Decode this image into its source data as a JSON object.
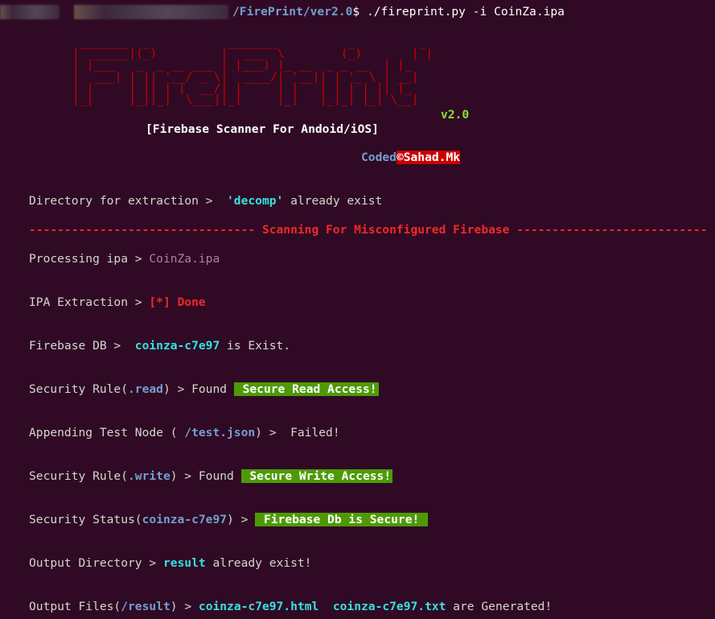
{
  "prompt": {
    "path": "/FirePrint/ver2.0",
    "symbol": "$",
    "command": " ./fireprint.py -i CoinZa.ipa"
  },
  "banner": {
    "ascii_art": " _______  _           _______          _         _\n|  _____|(_)         |  ___  \\        (_)       | |\n| |___   _  _ __ ___ | |___) )_ __  _ _ __  | |_\n|  ___| | || '__/ _ \\|  ____/| '__|| | '_ \\ | __|\n| |     | || | |  __/| |     | |   | | | | || |_\n|_|     |_||_|  \\___||_|     |_|   |_|_| |_| \\__|",
    "version": "v2.0",
    "subtitle": "[Firebase Scanner For Andoid/iOS]",
    "coded_label": "Coded",
    "author": "©Sahad.Mk"
  },
  "output": {
    "l1_a": "Directory for extraction >  ",
    "l1_b": "'decomp'",
    "l1_c": " already exist",
    "separator": "-------------------------------- Scanning For Misconfigured Firebase ---------------------------",
    "l2_a": "Processing ipa > ",
    "l2_b": "CoinZa.ipa",
    "l3_a": "IPA Extraction > ",
    "l3_b": "[*] Done",
    "l4_a": "Firebase DB >  ",
    "l4_b": "coinza-c7e97",
    "l4_c": " is Exist.",
    "l5_a": "Security Rule(",
    "l5_b": ".read",
    "l5_c": ") > Found ",
    "l5_d": " Secure Read Access!",
    "l6_a": "Appending Test Node ( ",
    "l6_b": "/test.json",
    "l6_c": ") >  Failed!",
    "l7_a": "Security Rule(",
    "l7_b": ".write",
    "l7_c": ") > Found ",
    "l7_d": " Secure Write Access!",
    "l8_a": "Security Status(",
    "l8_b": "coinza-c7e97",
    "l8_c": ") > ",
    "l8_d": " Firebase Db is Secure! ",
    "l9_a": "Output Directory > ",
    "l9_b": "result",
    "l9_c": " already exist!",
    "l10_a": "Output Files(",
    "l10_b": "/result",
    "l10_c": ") > ",
    "l10_d": "coinza-c7e97.html",
    "l10_e": "  ",
    "l10_f": "coinza-c7e97.txt",
    "l10_g": " are Generated!"
  },
  "colors": {
    "background": "#300a24",
    "text": "#d3d7cf",
    "accent_red": "#ef2929",
    "accent_green": "#4e9a06",
    "accent_cyan": "#34e2e2",
    "accent_blue": "#729fcf",
    "accent_purple": "#ad7fa8"
  }
}
